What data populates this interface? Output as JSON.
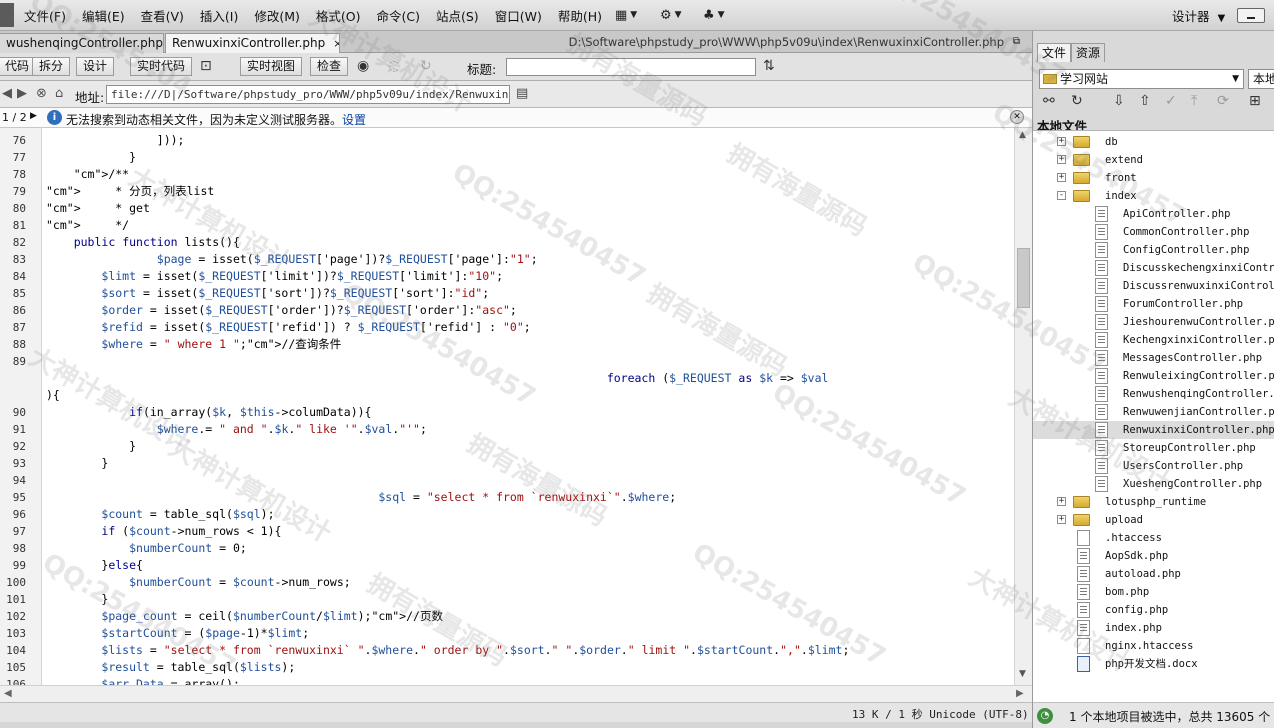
{
  "menubar": {
    "items": [
      "文件(F)",
      "编辑(E)",
      "查看(V)",
      "插入(I)",
      "修改(M)",
      "格式(O)",
      "命令(C)",
      "站点(S)",
      "窗口(W)",
      "帮助(H)"
    ],
    "designer_label": "设计器"
  },
  "tabs": [
    {
      "label": "wushenqingController.php",
      "close": "×"
    },
    {
      "label": "RenwuxinxiController.php",
      "close": "×"
    }
  ],
  "doc_path": "D:\\Software\\phpstudy_pro\\WWW\\php5v09u\\index\\RenwuxinxiController.php",
  "viewbar": {
    "code": "代码",
    "split": "拆分",
    "design": "设计",
    "live_code": "实时代码",
    "live_view": "实时视图",
    "inspect": "检查",
    "title_label": "标题:",
    "title_value": ""
  },
  "address": {
    "label": "地址:",
    "value": "file:///D|/Software/phpstudy_pro/WWW/php5v09u/index/RenwuxinxiC"
  },
  "infobar": {
    "page": "1 / 2",
    "message": "无法搜索到动态相关文件，因为未定义测试服务器。",
    "link": "设置"
  },
  "code_lines": [
    {
      "n": "76",
      "text": "                ]));"
    },
    {
      "n": "77",
      "text": "            }"
    },
    {
      "n": "78",
      "text": "    /**"
    },
    {
      "n": "79",
      "text": "     * 分页，列表list"
    },
    {
      "n": "80",
      "text": "     * get"
    },
    {
      "n": "81",
      "text": "     */"
    },
    {
      "n": "82",
      "text": "    public function lists(){"
    },
    {
      "n": "83",
      "text": "                $page = isset($_REQUEST['page'])?$_REQUEST['page']:\"1\";"
    },
    {
      "n": "84",
      "text": "        $limt = isset($_REQUEST['limit'])?$_REQUEST['limit']:\"10\";"
    },
    {
      "n": "85",
      "text": "        $sort = isset($_REQUEST['sort'])?$_REQUEST['sort']:\"id\";"
    },
    {
      "n": "86",
      "text": "        $order = isset($_REQUEST['order'])?$_REQUEST['order']:\"asc\";"
    },
    {
      "n": "87",
      "text": "        $refid = isset($_REQUEST['refid']) ? $_REQUEST['refid'] : \"0\";"
    },
    {
      "n": "88",
      "text": "        $where = \" where 1 \";//查询条件"
    },
    {
      "n": "89",
      "text": ""
    },
    {
      "n": "",
      "text": "                                                                                 foreach ($_REQUEST as $k => $val"
    },
    {
      "n": "",
      "text": "){"
    },
    {
      "n": "90",
      "text": "            if(in_array($k, $this->columData)){"
    },
    {
      "n": "91",
      "text": "                $where.= \" and \".$k.\" like '\".$val.\"'\";"
    },
    {
      "n": "92",
      "text": "            }"
    },
    {
      "n": "93",
      "text": "        }"
    },
    {
      "n": "94",
      "text": ""
    },
    {
      "n": "95",
      "text": "                                                $sql = \"select * from `renwuxinxi`\".$where;"
    },
    {
      "n": "96",
      "text": "        $count = table_sql($sql);"
    },
    {
      "n": "97",
      "text": "        if ($count->num_rows < 1){"
    },
    {
      "n": "98",
      "text": "            $numberCount = 0;"
    },
    {
      "n": "99",
      "text": "        }else{"
    },
    {
      "n": "100",
      "text": "            $numberCount = $count->num_rows;"
    },
    {
      "n": "101",
      "text": "        }"
    },
    {
      "n": "102",
      "text": "        $page_count = ceil($numberCount/$limt);//页数"
    },
    {
      "n": "103",
      "text": "        $startCount = ($page-1)*$limt;"
    },
    {
      "n": "104",
      "text": "        $lists = \"select * from `renwuxinxi` \".$where.\" order by \".$sort.\" \".$order.\" limit \".$startCount.\",\".$limt;"
    },
    {
      "n": "105",
      "text": "        $result = table_sql($lists);"
    },
    {
      "n": "106",
      "text": "        $arr_Data = array();"
    }
  ],
  "status": "13 K / 1 秒 Unicode (UTF-8)",
  "panel": {
    "tabs": [
      "文件",
      "资源"
    ],
    "site": "学习网站",
    "view": "本地视图",
    "local_files_label": "本地文件",
    "tree": [
      {
        "label": "db",
        "level": 1,
        "type": "folder",
        "exp": "+"
      },
      {
        "label": "extend",
        "level": 1,
        "type": "folder",
        "exp": "+"
      },
      {
        "label": "front",
        "level": 1,
        "type": "folder",
        "exp": "+"
      },
      {
        "label": "index",
        "level": 1,
        "type": "folder",
        "exp": "-"
      },
      {
        "label": "ApiController.php",
        "level": 2,
        "type": "php"
      },
      {
        "label": "CommonController.php",
        "level": 2,
        "type": "php"
      },
      {
        "label": "ConfigController.php",
        "level": 2,
        "type": "php"
      },
      {
        "label": "DiscusskechengxinxiControlle",
        "level": 2,
        "type": "php"
      },
      {
        "label": "DiscussrenwuxinxiController",
        "level": 2,
        "type": "php"
      },
      {
        "label": "ForumController.php",
        "level": 2,
        "type": "php"
      },
      {
        "label": "JieshourenwuController.php",
        "level": 2,
        "type": "php"
      },
      {
        "label": "KechengxinxiController.php",
        "level": 2,
        "type": "php"
      },
      {
        "label": "MessagesController.php",
        "level": 2,
        "type": "php"
      },
      {
        "label": "RenwuleixingController.php",
        "level": 2,
        "type": "php"
      },
      {
        "label": "RenwushenqingController.php",
        "level": 2,
        "type": "php"
      },
      {
        "label": "RenwuwenjianController.php",
        "level": 2,
        "type": "php"
      },
      {
        "label": "RenwuxinxiController.php",
        "level": 2,
        "type": "php",
        "selected": true
      },
      {
        "label": "StoreupController.php",
        "level": 2,
        "type": "php"
      },
      {
        "label": "UsersController.php",
        "level": 2,
        "type": "php"
      },
      {
        "label": "XueshengController.php",
        "level": 2,
        "type": "php"
      },
      {
        "label": "lotusphp_runtime",
        "level": 1,
        "type": "folder",
        "exp": "+"
      },
      {
        "label": "upload",
        "level": 1,
        "type": "folder",
        "exp": "+"
      },
      {
        "label": ".htaccess",
        "level": 1,
        "type": "file"
      },
      {
        "label": "AopSdk.php",
        "level": 1,
        "type": "php"
      },
      {
        "label": "autoload.php",
        "level": 1,
        "type": "php"
      },
      {
        "label": "bom.php",
        "level": 1,
        "type": "php"
      },
      {
        "label": "config.php",
        "level": 1,
        "type": "php"
      },
      {
        "label": "index.php",
        "level": 1,
        "type": "php"
      },
      {
        "label": "nginx.htaccess",
        "level": 1,
        "type": "file"
      },
      {
        "label": "php开发文档.docx",
        "level": 1,
        "type": "doc"
      }
    ],
    "status": "1 个本地项目被选中，总共 13605 个"
  },
  "watermark": {
    "texts": [
      "QQ:2545404",
      "大神计算机设计",
      "拥有海量源码",
      "QQ:254540457",
      "大神计算机设计",
      "QQ:254540457",
      "拥有海量源码",
      "QQ:254540457",
      "大神计算机设计",
      "QQ:254540457",
      "拥有海量源码",
      "QQ:254540457",
      "大神计算机设计",
      "拥有海量源码",
      "QQ:254540457",
      "大神计算机设计",
      "QQ:254540457",
      "拥有海量源码",
      "QQ:254540457",
      "大神计算机设计"
    ]
  }
}
